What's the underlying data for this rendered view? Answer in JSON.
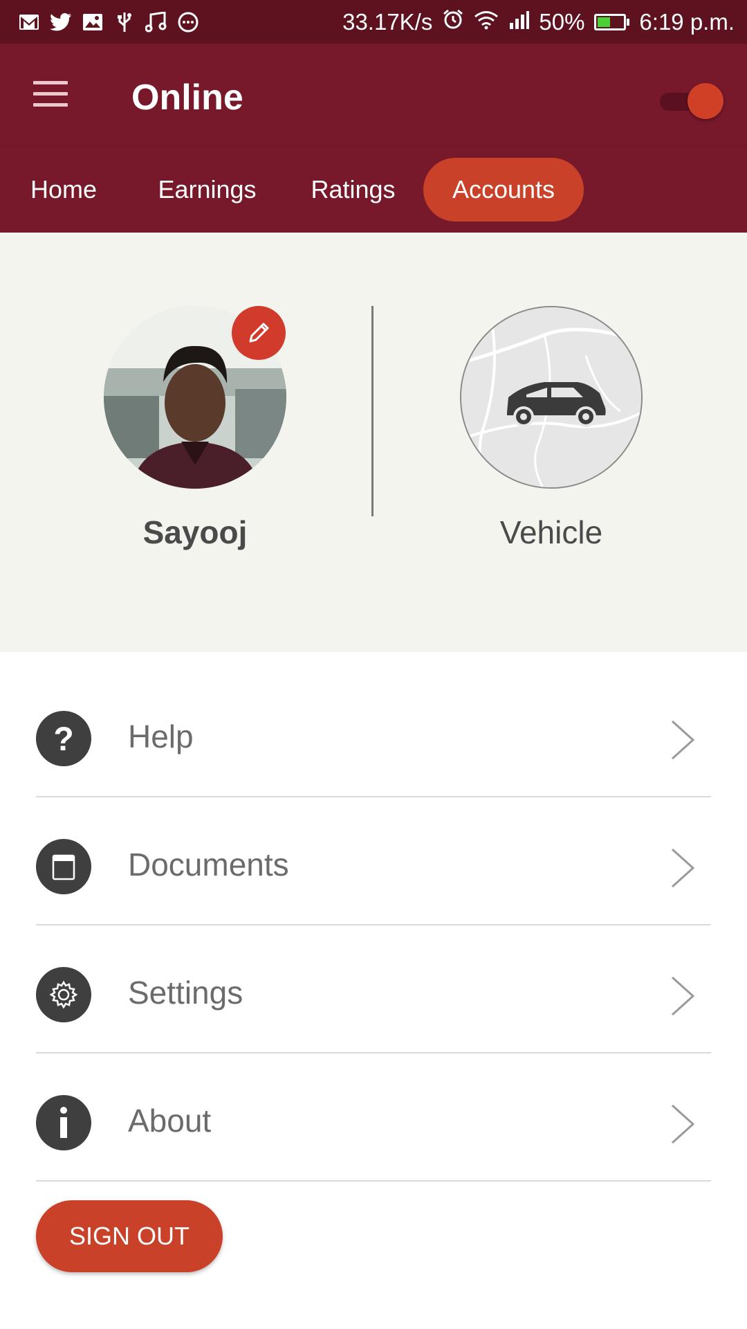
{
  "status_bar": {
    "icons": [
      "gmail-icon",
      "twitter-icon",
      "image-icon",
      "usb-icon",
      "music-icon",
      "more-icon"
    ],
    "speed": "33.17K/s",
    "battery": "50%",
    "battery_level": 0.5,
    "time": "6:19 p.m."
  },
  "app_bar": {
    "title": "Online",
    "online_toggle": true
  },
  "tabs": [
    {
      "label": "Home",
      "active": false
    },
    {
      "label": "Earnings",
      "active": false
    },
    {
      "label": "Ratings",
      "active": false
    },
    {
      "label": "Accounts",
      "active": true
    }
  ],
  "profile": {
    "name": "Sayooj",
    "vehicle_label": "Vehicle"
  },
  "menu": [
    {
      "label": "Help",
      "icon": "help-icon"
    },
    {
      "label": "Documents",
      "icon": "document-icon"
    },
    {
      "label": "Settings",
      "icon": "gear-icon"
    },
    {
      "label": "About",
      "icon": "info-icon"
    }
  ],
  "sign_out_label": "SIGN OUT",
  "colors": {
    "status_bar": "#5e1220",
    "primary": "#77182b",
    "accent": "#c94128",
    "profile_bg": "#f3f4ee"
  }
}
